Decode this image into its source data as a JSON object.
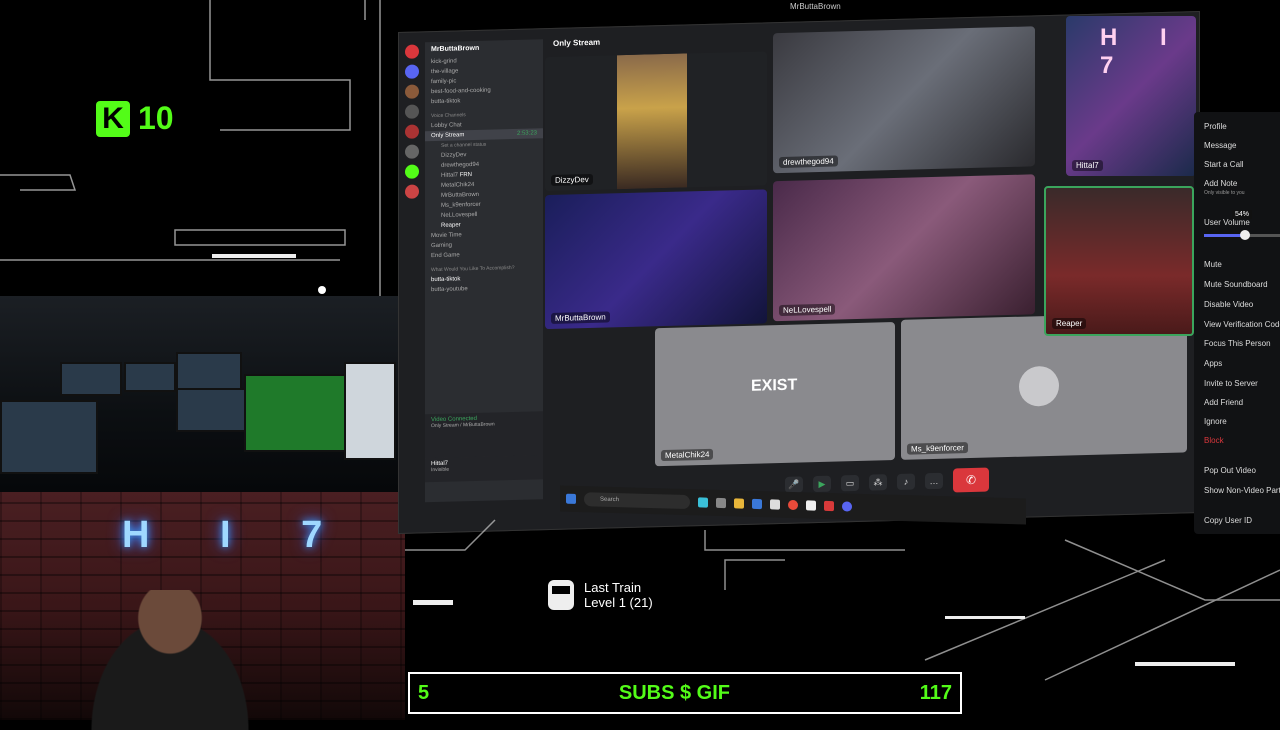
{
  "overlay": {
    "kick_count": "10",
    "neon_sign": "H I 7",
    "train_title": "Last Train",
    "train_level": "Level 1  (21)",
    "goal_left": "5",
    "goal_label": "SUBS $ GIF",
    "goal_right": "117"
  },
  "window_title": "MrButtaBrown",
  "discord": {
    "server_name": "MrButtaBrown",
    "channels": [
      "kick-grind",
      "the-village",
      "family-pic",
      "best-food-and-cooking",
      "butta-tiktok"
    ],
    "voice_category": "Voice Channels",
    "voice_channels": [
      "Lobby Chat",
      "Only Stream"
    ],
    "active_channel_status": "Set a channel status",
    "call_timer": "2:53:23",
    "participants": [
      "DizzyDev",
      "drewthegod94",
      "Hittal7",
      "MetalChik24",
      "MrButtaBrown",
      "Ms_k9enforcer",
      "NeLLovespell",
      "Reaper"
    ],
    "hittal_badge": "FRN",
    "more_voice": [
      "Movie Time",
      "Gaming",
      "End Game"
    ],
    "category2": "What Would You Like To Accomplish?",
    "channels2": [
      "butta-tiktok",
      "butta-youtube"
    ],
    "voice_connected": "Video Connected",
    "voice_connected_sub": "Only Stream / MrButtaBrown",
    "user_name": "Hittal7",
    "user_status": "Invisible",
    "stage_title": "Only Stream",
    "tiles": {
      "dizzy": "DizzyDev",
      "drew": "drewthegod94",
      "hittal": "Hittal7",
      "butta": "MrButtaBrown",
      "nell": "NeLLovespell",
      "reaper": "Reaper",
      "metal": "MetalChik24",
      "ms": "Ms_k9enforcer"
    },
    "metal_logo": "EXIST",
    "search_placeholder": "Search"
  },
  "context_menu": {
    "items": [
      "Profile",
      "Message",
      "Start a Call",
      "Add Note"
    ],
    "add_note_sub": "Only visible to you",
    "user_volume": "User Volume",
    "volume_pct": "54%",
    "volume_value": 0.54,
    "items2": [
      "Mute",
      "Mute Soundboard",
      "Disable Video",
      "View Verification Codes",
      "Focus This Person",
      "Apps",
      "Invite to Server",
      "Add Friend",
      "Ignore"
    ],
    "block": "Block",
    "items3": [
      "Pop Out Video",
      "Show Non-Video Participants"
    ],
    "copy_id": "Copy User ID"
  },
  "colors": {
    "kick_green": "#53fc18",
    "discord_blurple": "#5865f2",
    "danger": "#da373c"
  }
}
